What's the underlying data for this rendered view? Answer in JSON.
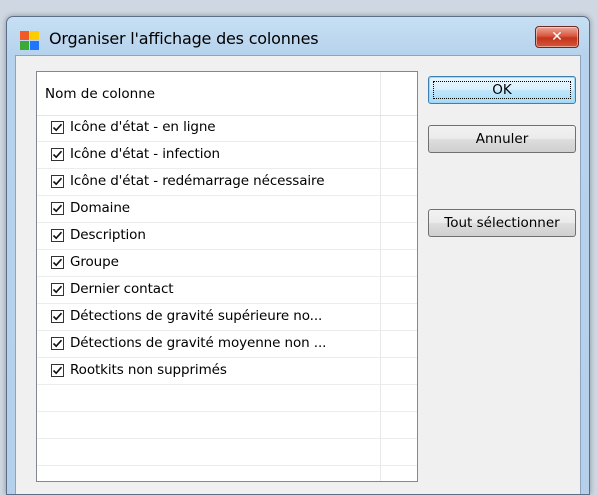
{
  "window": {
    "title": "Organiser l'affichage des colonnes",
    "close_glyph": "✕"
  },
  "list": {
    "header": "Nom de colonne",
    "items": [
      {
        "label": "Icône d'état - en ligne",
        "checked": true
      },
      {
        "label": "Icône d'état - infection",
        "checked": true
      },
      {
        "label": "Icône d'état - redémarrage nécessaire",
        "checked": true
      },
      {
        "label": "Domaine",
        "checked": true
      },
      {
        "label": "Description",
        "checked": true
      },
      {
        "label": "Groupe",
        "checked": true
      },
      {
        "label": "Dernier contact",
        "checked": true
      },
      {
        "label": "Détections de gravité supérieure no...",
        "checked": true
      },
      {
        "label": "Détections de gravité moyenne non ...",
        "checked": true
      },
      {
        "label": "Rootkits non supprimés",
        "checked": true
      }
    ]
  },
  "buttons": {
    "ok": "OK",
    "cancel": "Annuler",
    "select_all": "Tout sélectionner"
  },
  "icons": {
    "app": "avg-logo-icon",
    "close": "close-icon",
    "checkbox": "checkmark-icon"
  }
}
